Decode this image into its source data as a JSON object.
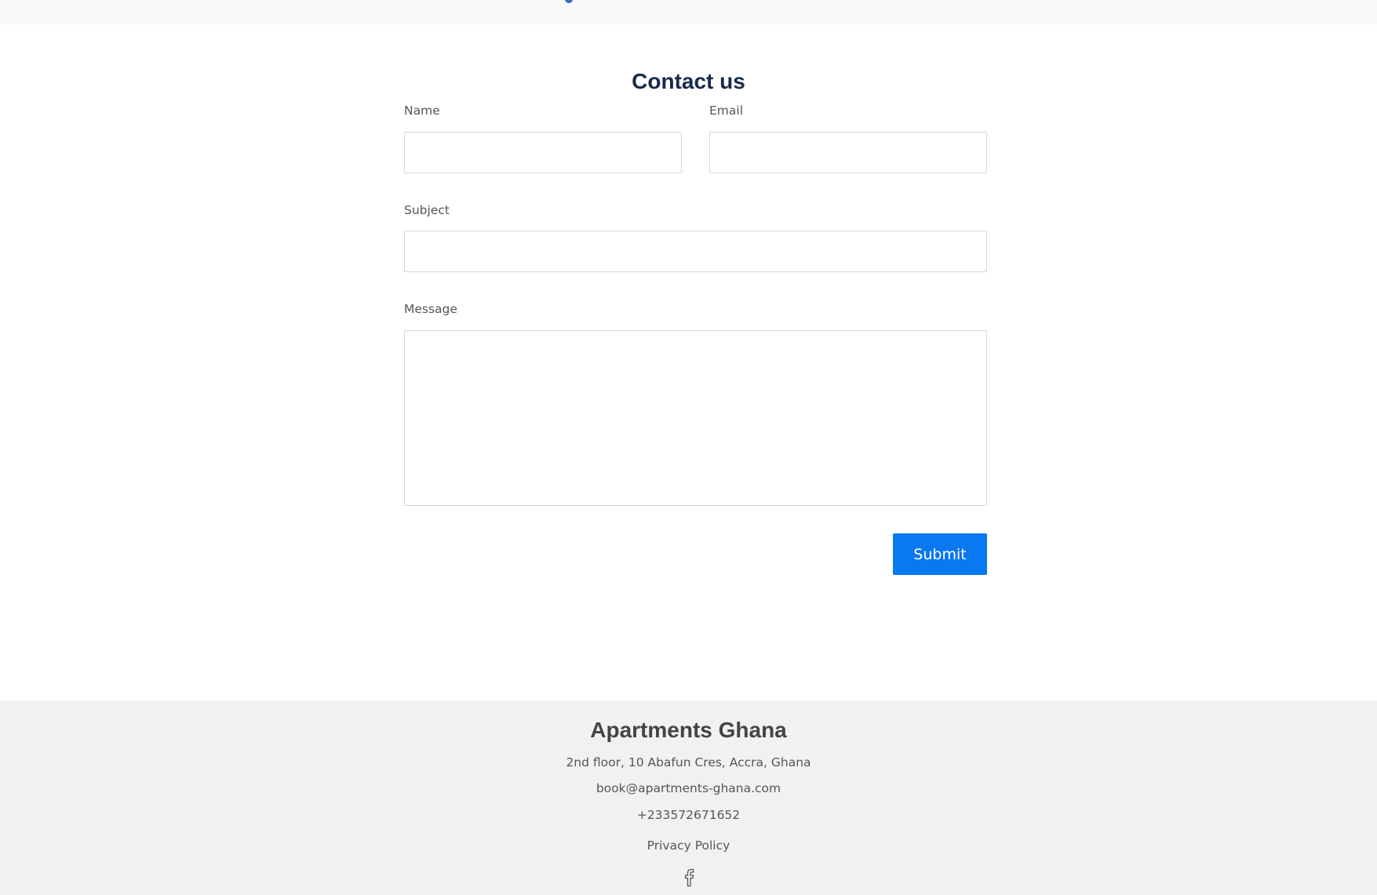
{
  "page": {
    "title": "Contact us"
  },
  "form": {
    "name_label": "Name",
    "email_label": "Email",
    "subject_label": "Subject",
    "message_label": "Message",
    "name_value": "",
    "email_value": "",
    "subject_value": "",
    "message_value": "",
    "submit_label": "Submit"
  },
  "footer": {
    "brand": "Apartments Ghana",
    "address": "2nd floor, 10 Abafun Cres, Accra, Ghana",
    "email": "book@apartments-ghana.com",
    "phone": "+233572671652",
    "privacy_link": "Privacy Policy",
    "social_icon": "facebook-icon"
  },
  "colors": {
    "accent": "#0a78f0",
    "heading": "#172b4d",
    "footer_bg": "#f1f1f1",
    "text_muted": "#555555"
  }
}
